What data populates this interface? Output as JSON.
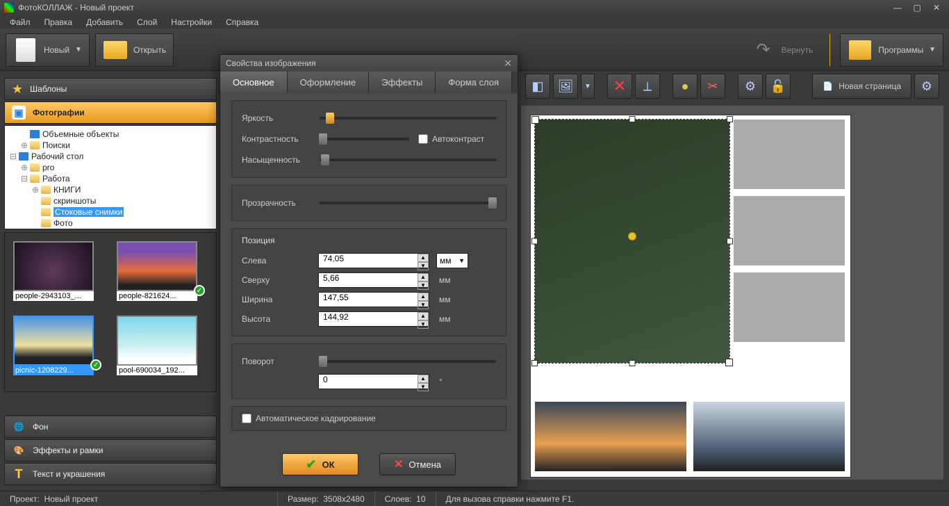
{
  "app_title": "ФотоКОЛЛАЖ - Новый проект",
  "menu": [
    "Файл",
    "Правка",
    "Добавить",
    "Слой",
    "Настройки",
    "Справка"
  ],
  "toolbar": {
    "new": "Новый",
    "open": "Открыть",
    "return": "Вернуть",
    "programs": "Программы"
  },
  "tools2": {
    "new_page": "Новая страница"
  },
  "accordion": {
    "templates": "Шаблоны",
    "photos": "Фотографии",
    "background": "Фон",
    "effects": "Эффекты и рамки",
    "text": "Текст и украшения"
  },
  "tree": {
    "bulk": "Объемные объекты",
    "search": "Поиски",
    "desktop": "Рабочий стол",
    "pro": "pro",
    "work": "Работа",
    "books": "КНИГИ",
    "screens": "скриншоты",
    "stock": "Стоковые снимки",
    "photo": "Фото"
  },
  "thumbs": {
    "t1": "people-2943103_...",
    "t2": "people-821624...",
    "t3": "picnic-1208229...",
    "t4": "pool-690034_192..."
  },
  "dialog": {
    "title": "Свойства изображения",
    "tabs": {
      "main": "Основное",
      "design": "Оформление",
      "effects": "Эффекты",
      "shape": "Форма слоя"
    },
    "brightness": "Яркость",
    "contrast": "Контрастность",
    "saturation": "Насыщенность",
    "autocontrast": "Автоконтраст",
    "opacity": "Прозрачность",
    "position_section": "Позиция",
    "left": "Слева",
    "left_val": "74,05",
    "top": "Сверху",
    "top_val": "5,66",
    "width": "Ширина",
    "width_val": "147,55",
    "height": "Высота",
    "height_val": "144,92",
    "unit": "мм",
    "rotation": "Поворот",
    "rotation_val": "0",
    "deg": "°",
    "autocrop": "Автоматическое кадрирование",
    "ok": "ОК",
    "cancel": "Отмена"
  },
  "status": {
    "project_label": "Проект:",
    "project": "Новый проект",
    "size_label": "Размер:",
    "size": "3508x2480",
    "layers_label": "Слоев:",
    "layers": "10",
    "hint": "Для вызова справки нажмите F1."
  }
}
